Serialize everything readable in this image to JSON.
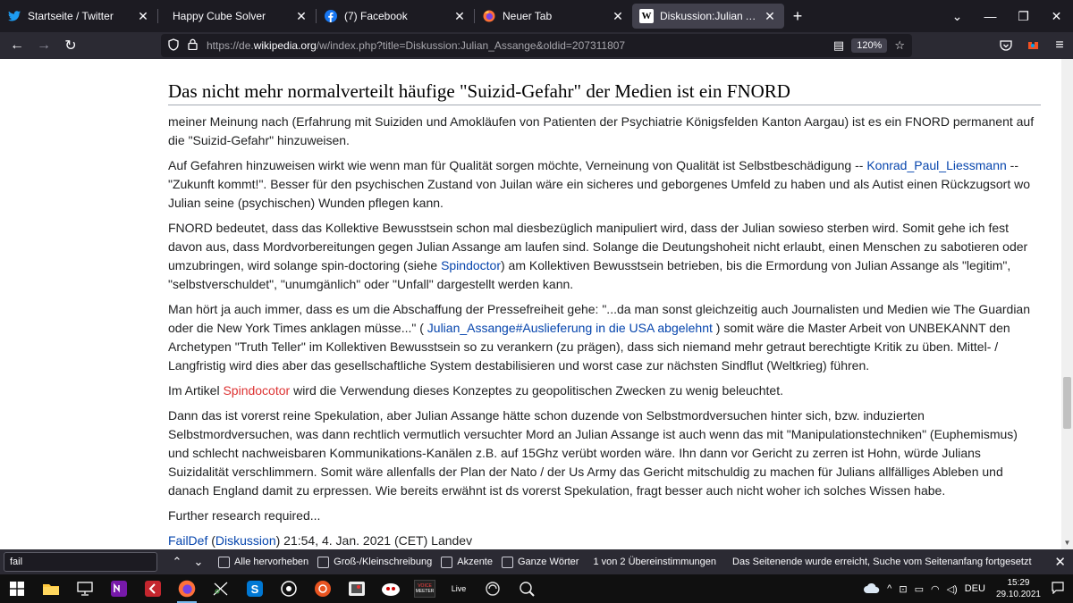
{
  "browser": {
    "tabs": [
      {
        "label": "Startseite / Twitter",
        "icon": "twitter-icon",
        "active": false
      },
      {
        "label": "Happy Cube Solver",
        "icon": "none",
        "active": false
      },
      {
        "label": "(7) Facebook",
        "icon": "facebook-icon",
        "active": false
      },
      {
        "label": "Neuer Tab",
        "icon": "firefox-icon",
        "active": false
      },
      {
        "label": "Diskussion:Julian Assange – Wiki",
        "icon": "wikipedia-icon",
        "active": true
      }
    ],
    "new_tab_symbol": "+",
    "url_prefix": "https://de.",
    "url_domain": "wikipedia.org",
    "url_rest": "/w/index.php?title=Diskussion:Julian_Assange&oldid=207311807",
    "zoom": "120%"
  },
  "article": {
    "heading": "Das nicht mehr normalverteilt häufige \"Suizid-Gefahr\" der Medien ist ein FNORD",
    "p1": "meiner Meinung nach (Erfahrung mit Suiziden und Amokläufen von Patienten der Psychiatrie Königsfelden Kanton Aargau) ist es ein FNORD permanent auf die \"Suizid-Gefahr\" hinzuweisen.",
    "p2_a": "Auf Gefahren hinzuweisen wirkt wie wenn man für Qualität sorgen möchte, Verneinung von Qualität ist Selbstbeschädigung -- ",
    "p2_link": "Konrad_Paul_Liessmann",
    "p2_b": " -- \"Zukunft kommt!\". Besser für den psychischen Zustand von Juilan wäre ein sicheres und geborgenes Umfeld zu haben und als Autist einen Rückzugsort wo Julian seine (psychischen) Wunden pflegen kann.",
    "p3_a": "FNORD bedeutet, dass das Kollektive Bewusstsein schon mal diesbezüglich manipuliert wird, dass der Julian sowieso sterben wird. Somit gehe ich fest davon aus, dass Mordvorbereitungen gegen Julian Assange am laufen sind. Solange die Deutungshoheit nicht erlaubt, einen Menschen zu sabotieren oder umzubringen, wird solange spin-doctoring (siehe ",
    "p3_link": "Spindoctor",
    "p3_b": ") am Kollektiven Bewusstsein betrieben, bis die Ermordung von Julian Assange als \"legitim\", \"selbstverschuldet\", \"unumgänlich\" oder \"Unfall\" dargestellt werden kann.",
    "p4_a": "Man hört ja auch immer, dass es um die Abschaffung der Pressefreiheit gehe: \"...da man sonst gleichzeitig auch Journalisten und Medien wie The Guardian oder die New York Times anklagen müsse...\" ( ",
    "p4_link": "Julian_Assange#Auslieferung in die USA abgelehnt",
    "p4_b": " ) somit wäre die Master Arbeit von UNBEKANNT den Archetypen \"Truth Teller\" im Kollektiven Bewusstsein so zu verankern (zu prägen), dass sich niemand mehr getraut berechtigte Kritik zu üben. Mittel- / Langfristig wird dies aber das gesellschaftliche System destabilisieren und worst case zur nächsten Sindflut (Weltkrieg) führen.",
    "p5_a": "Im Artikel ",
    "p5_link": "Spindocotor",
    "p5_b": " wird die Verwendung dieses Konzeptes zu geopolitischen Zwecken zu wenig beleuchtet.",
    "p6": "Dann das ist vorerst reine Spekulation, aber Julian Assange hätte schon duzende von Selbstmordversuchen hinter sich, bzw. induzierten Selbstmordversuchen, was dann rechtlich vermutlich versuchter Mord an Julian Assange ist auch wenn das mit \"Manipulationstechniken\" (Euphemismus) und schlecht nachweisbaren Kommunikations-Kanälen z.B. auf 15Ghz verübt worden wäre. Ihn dann vor Gericht zu zerren ist Hohn, würde Julians Suizidalität verschlimmern. Somit wäre allenfalls der Plan der Nato / der Us Army das Gericht mitschuldig zu machen für Julians allfälliges Ableben und danach England damit zu erpressen. Wie bereits erwähnt ist ds vorerst Spekulation, fragt besser auch nicht woher ich solches Wissen habe.",
    "p7": "Further research required...",
    "sig_user": "FailDef",
    "sig_open": " (",
    "sig_talk": "Diskussion",
    "sig_rest": ") 21:54, 4. Jan. 2021 (CET) Landev"
  },
  "findbar": {
    "value": "fail",
    "highlight_all": "Alle hervorheben",
    "match_case": "Groß-/Kleinschreibung",
    "diacritics": "Akzente",
    "whole_words": "Ganze Wörter",
    "matches": "1 von 2 Übereinstimmungen",
    "status": "Das Seitenende wurde erreicht, Suche vom Seitenanfang fortgesetzt"
  },
  "taskbar": {
    "language": "DEU",
    "time": "15:29",
    "date": "29.10.2021",
    "app_voice_label": "VOICE",
    "app_voice_sub": "MEETER",
    "app_live_label": "Live"
  }
}
